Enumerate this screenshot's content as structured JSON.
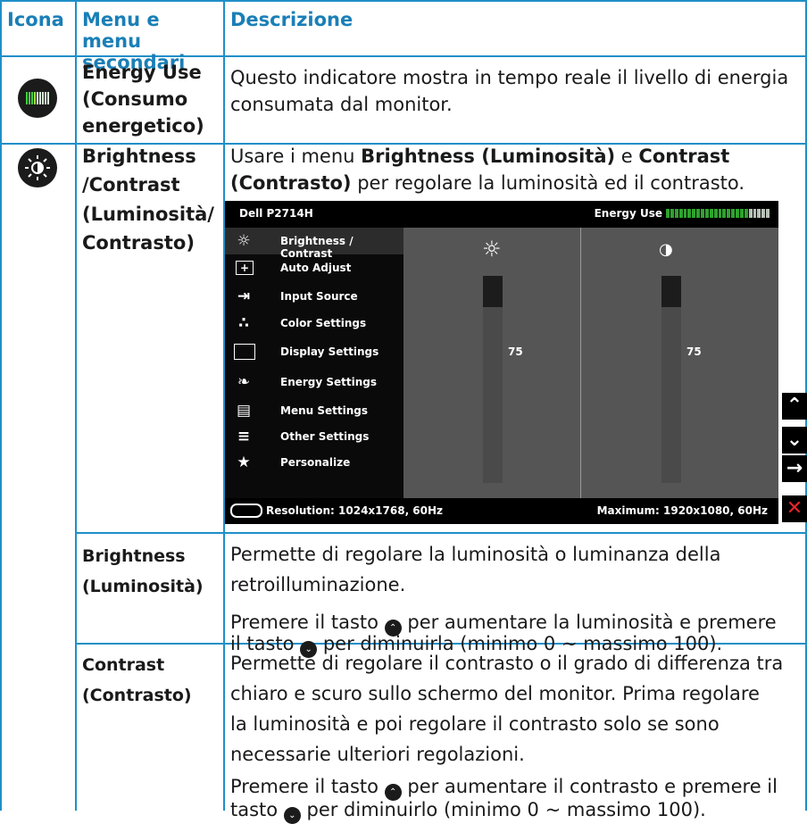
{
  "header": {
    "col1": "Icona",
    "col2": "Menu e menu secondari",
    "col3": "Descrizione"
  },
  "rows": {
    "energy": {
      "menu": "Energy Use (Consumo energetico)",
      "desc": "Questo indicatore mostra in tempo reale il livello di energia consumata dal monitor."
    },
    "brightness_contrast": {
      "menu_line1": "Brightness",
      "menu_line2": "/Contrast",
      "menu_line3": "(Luminosità/",
      "menu_line4": "Contrasto)",
      "desc_pre": "Usare i menu ",
      "desc_b1": "Brightness (Luminosità)",
      "desc_mid": " e ",
      "desc_b2a": "Contrast",
      "desc_b2b": "(Contrasto)",
      "desc_post": " per regolare la luminosità ed il contrasto."
    },
    "brightness": {
      "menu_line1": "Brightness",
      "menu_line2": "(Luminosità)",
      "desc1_l1": "Permette di regolare la luminosità o luminanza della",
      "desc1_l2": "retroilluminazione.",
      "desc2_a": "Premere il tasto ",
      "desc2_b": " per aumentare la luminosità e premere",
      "desc2_c": "il tasto ",
      "desc2_d": " per diminuirla (minimo 0 ~ massimo 100)."
    },
    "contrast": {
      "menu_line1": "Contrast",
      "menu_line2": "(Contrasto)",
      "desc1_l1": "Permette di regolare il contrasto o il grado di differenza tra",
      "desc1_l2": "chiaro e scuro sullo schermo del monitor. Prima regolare",
      "desc1_l3": "la luminosità e poi regolare il contrasto solo se sono",
      "desc1_l4": "necessarie ulteriori regolazioni.",
      "desc2_a": "Premere il tasto ",
      "desc2_b": " per aumentare il contrasto e premere il",
      "desc2_c": "tasto ",
      "desc2_d": " per diminuirlo (minimo 0 ~ massimo 100)."
    }
  },
  "osd": {
    "title": "Dell P2714H",
    "energy_label": "Energy Use",
    "energy_level": 0.8,
    "menu": [
      {
        "label": "Brightness / Contrast",
        "icon": "brightness-contrast-icon"
      },
      {
        "label": "Auto Adjust",
        "icon": "auto-adjust-icon"
      },
      {
        "label": "Input Source",
        "icon": "input-source-icon"
      },
      {
        "label": "Color Settings",
        "icon": "color-settings-icon"
      },
      {
        "label": "Display Settings",
        "icon": "display-settings-icon"
      },
      {
        "label": "Energy Settings",
        "icon": "energy-settings-icon"
      },
      {
        "label": "Menu Settings",
        "icon": "menu-settings-icon"
      },
      {
        "label": "Other Settings",
        "icon": "other-settings-icon"
      },
      {
        "label": "Personalize",
        "icon": "personalize-icon"
      }
    ],
    "brightness_value": "75",
    "contrast_value": "75",
    "resolution": "Resolution: 1024x1768, 60Hz",
    "maximum": "Maximum: 1920x1080, 60Hz",
    "side_buttons": [
      "up-arrow-icon",
      "down-arrow-icon",
      "right-arrow-icon",
      "close-icon"
    ]
  }
}
